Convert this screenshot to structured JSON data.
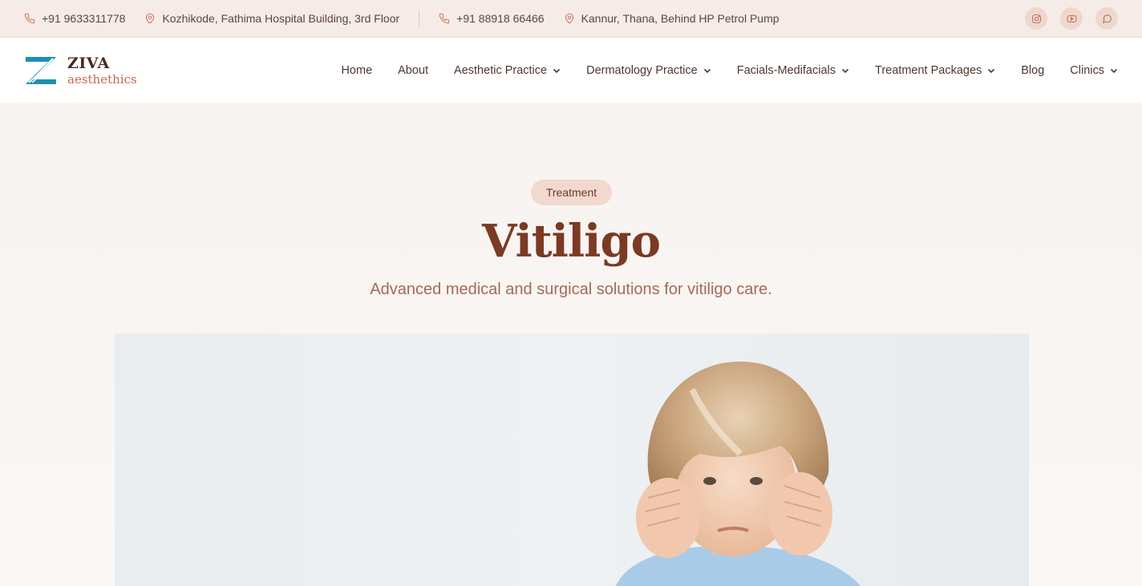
{
  "topbar": {
    "phone1": "+91 9633311778",
    "address1": "Kozhikode, Fathima Hospital Building, 3rd Floor",
    "phone2": "+91 88918 66466",
    "address2": "Kannur, Thana, Behind HP Petrol Pump",
    "social": [
      "instagram-icon",
      "youtube-icon",
      "whatsapp-icon"
    ]
  },
  "brand": {
    "name_top": "ZIVA",
    "name_bottom": "aesthethics",
    "colors": {
      "primary": "#7b3a22",
      "accent": "#c8684e",
      "logo_teal": "#1f8fb0"
    }
  },
  "nav": {
    "items": [
      {
        "label": "Home",
        "dropdown": false
      },
      {
        "label": "About",
        "dropdown": false
      },
      {
        "label": "Aesthetic Practice",
        "dropdown": true
      },
      {
        "label": "Dermatology Practice",
        "dropdown": true
      },
      {
        "label": "Facials-Medifacials",
        "dropdown": true
      },
      {
        "label": "Treatment Packages",
        "dropdown": true
      },
      {
        "label": "Blog",
        "dropdown": false
      },
      {
        "label": "Clinics",
        "dropdown": true
      }
    ]
  },
  "hero": {
    "badge": "Treatment",
    "title": "Vitiligo",
    "subtitle": "Advanced medical and surgical solutions for vitiligo care."
  }
}
